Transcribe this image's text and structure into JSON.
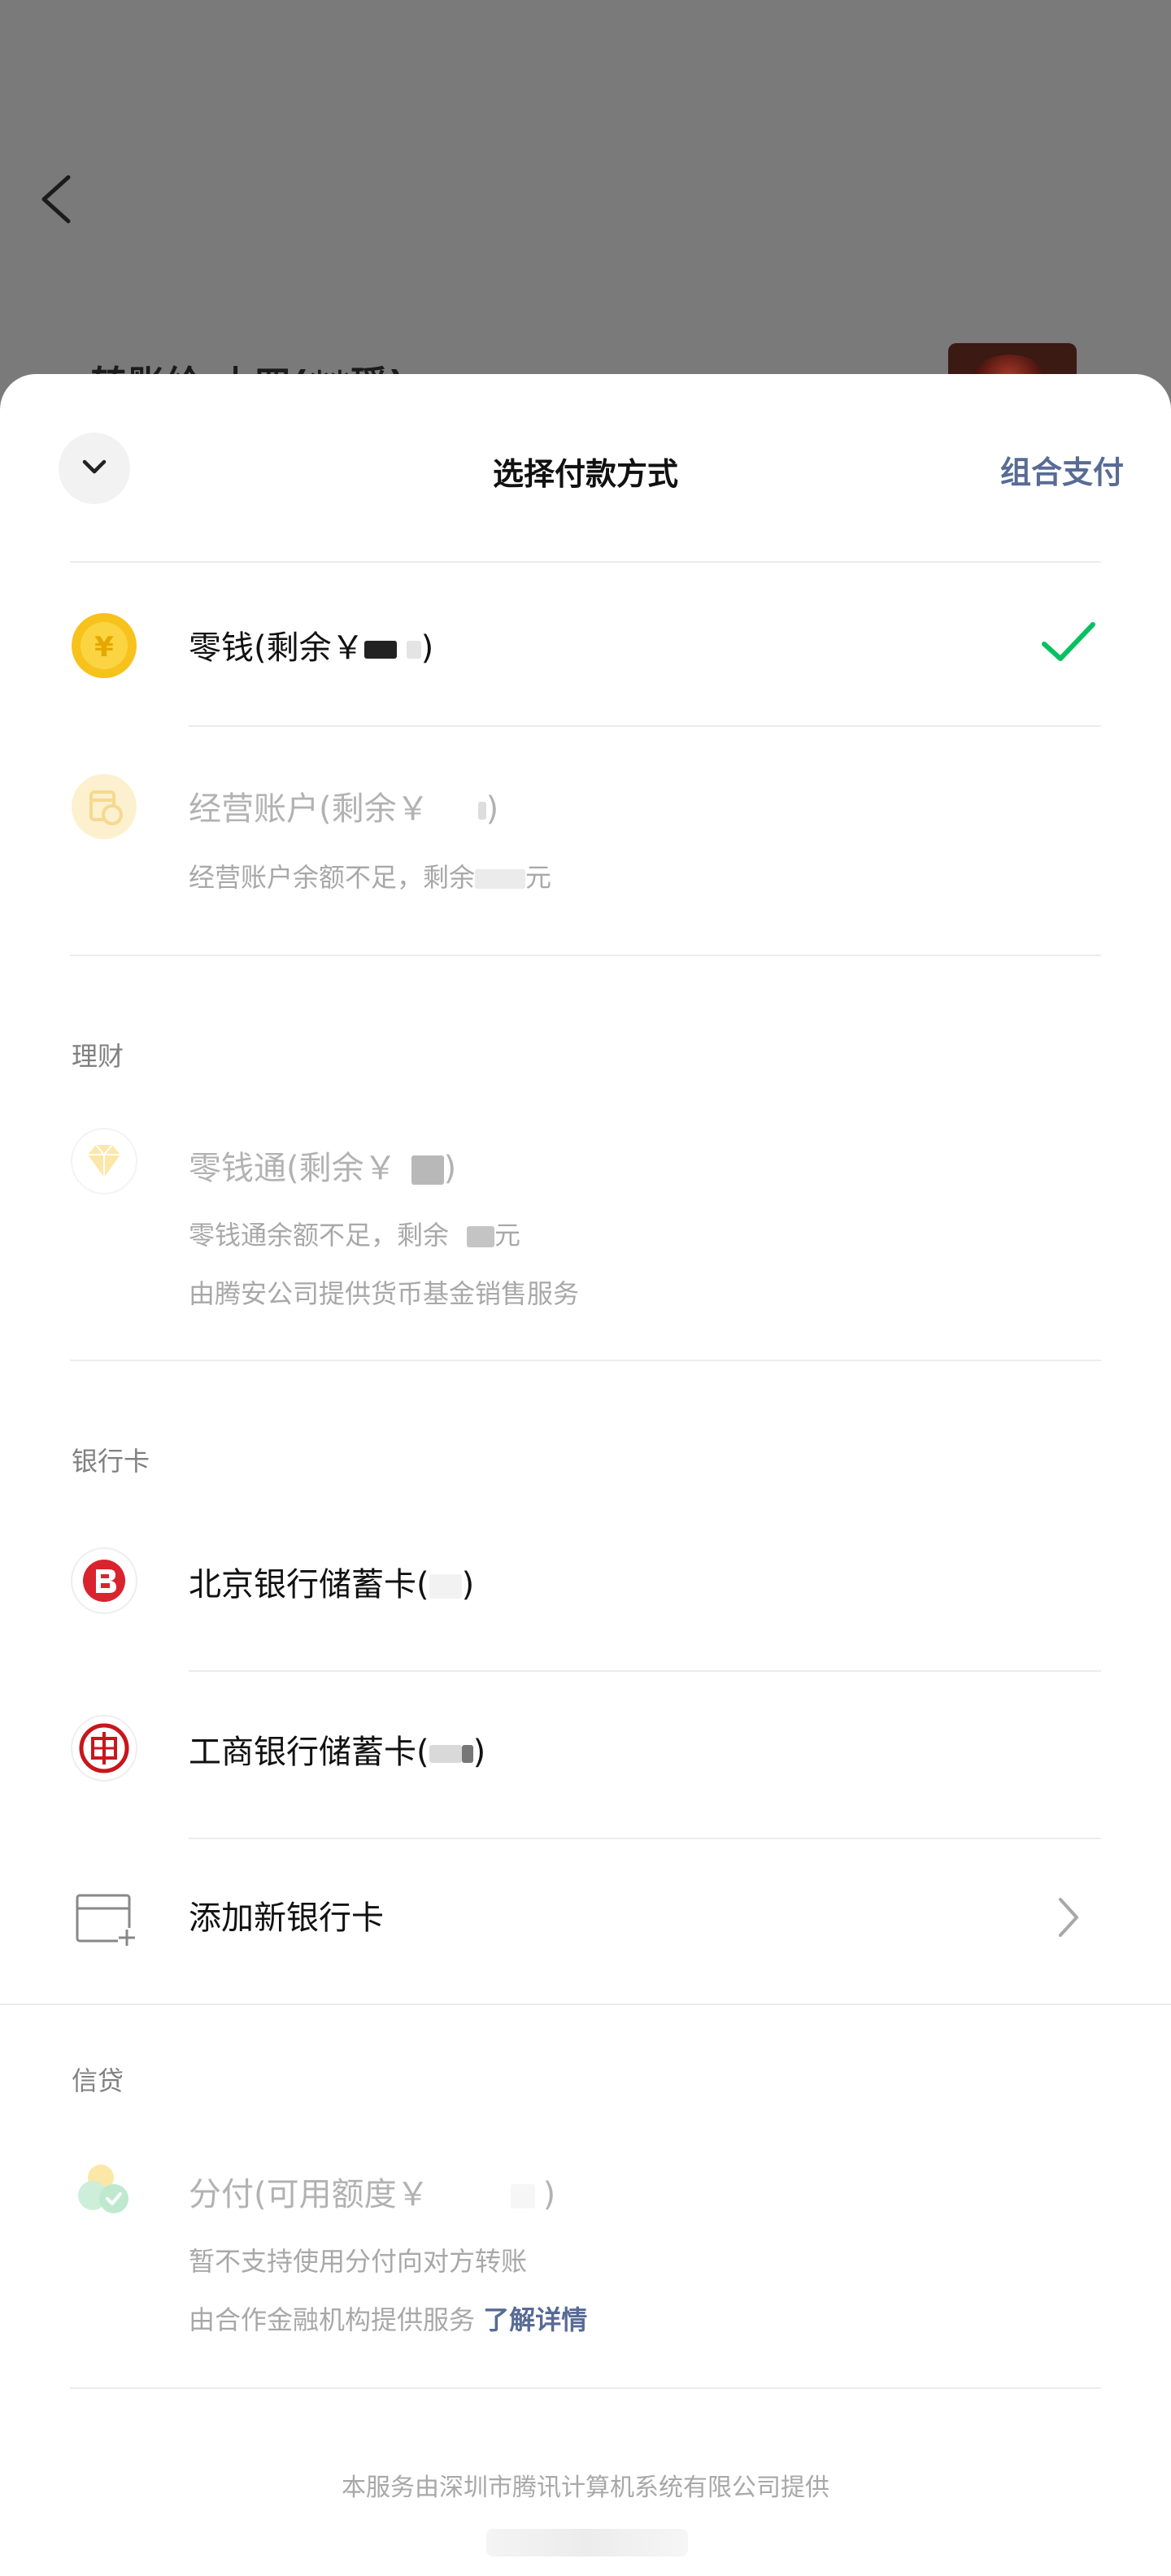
{
  "background": {
    "title": "转账给 小四(**瑶)",
    "thumbnail_icon": "chat-avatar-image"
  },
  "sheet": {
    "title": "选择付款方式",
    "combo_pay": "组合支付",
    "collapse_icon": "chevron-down-icon"
  },
  "wallet": {
    "label_prefix": "零钱(剩余￥",
    "label_suffix": ")",
    "selected": true
  },
  "business": {
    "label_prefix": "经营账户(剩余￥",
    "label_suffix": ")",
    "note_prefix": "经营账户余额不足，剩余",
    "note_suffix": "元"
  },
  "sections": {
    "wealth": "理财",
    "bank": "银行卡",
    "credit": "信贷"
  },
  "lqt": {
    "label_prefix": "零钱通(剩余￥",
    "label_suffix": ")",
    "note1_prefix": "零钱通余额不足，剩余",
    "note1_suffix": "元",
    "note2": "由腾安公司提供货币基金销售服务"
  },
  "banks": [
    {
      "label_prefix": "北京银行储蓄卡(",
      "label_suffix": ")",
      "icon": "bank-of-beijing-icon"
    },
    {
      "label_prefix": "工商银行储蓄卡(",
      "label_suffix": ")",
      "icon": "icbc-icon"
    }
  ],
  "add_card": {
    "label": "添加新银行卡",
    "icon": "add-card-icon"
  },
  "fenfu": {
    "label_prefix": "分付(可用额度￥",
    "label_suffix": ")",
    "note1": "暂不支持使用分付向对方转账",
    "note2_prefix": "由合作金融机构提供服务",
    "note2_link": "了解详情"
  },
  "footer": "本服务由深圳市腾讯计算机系统有限公司提供",
  "colors": {
    "accent": "#576b95",
    "check": "#07c160",
    "coin": "#f7c21c",
    "bank_red": "#d9242f"
  }
}
